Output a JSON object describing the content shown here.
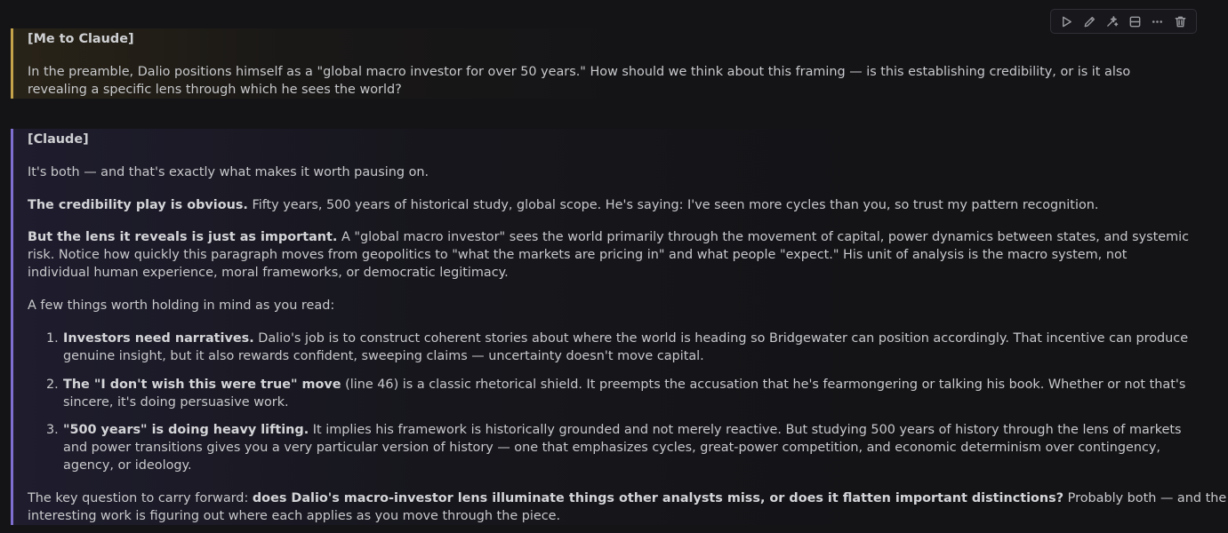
{
  "toolbar": {
    "items": [
      {
        "icon": "play-icon"
      },
      {
        "icon": "pencil-icon"
      },
      {
        "icon": "sparkles-icon"
      },
      {
        "icon": "split-icon"
      },
      {
        "icon": "more-icon"
      },
      {
        "icon": "trash-icon"
      }
    ]
  },
  "me_block": {
    "heading": "[Me to Claude]",
    "lines": [
      "In the preamble, Dalio positions himself as a \"global macro investor for over 50 years.\" How should we think about this framing — is this establishing credibility, or is it also",
      "revealing a specific lens through which he sees the world?"
    ]
  },
  "claude_block": {
    "heading": "[Claude]",
    "intro": "It's both — and that's exactly what makes it worth pausing on.",
    "p1": {
      "bold": "The credibility play is obvious.",
      "rest": " Fifty years, 500 years of historical study, global scope. He's saying: I've seen more cycles than you, so trust my pattern recognition."
    },
    "p2": {
      "bold": "But the lens it reveals is just as important.",
      "line1_rest": " A \"global macro investor\" sees the world primarily through the movement of capital, power dynamics between states, and systemic",
      "line2": "risk. Notice how quickly this paragraph moves from geopolitics to \"what the markets are pricing in\" and what people \"expect.\" His unit of analysis is the macro system, not",
      "line3": "individual human experience, moral frameworks, or democratic legitimacy."
    },
    "p3": "A few things worth holding in mind as you read:",
    "list": [
      {
        "num": "1.",
        "bold": "Investors need narratives.",
        "line1_rest": " Dalio's job is to construct coherent stories about where the world is heading so Bridgewater can position accordingly. That incentive can produce",
        "line2": "genuine insight, but it also rewards confident, sweeping claims — uncertainty doesn't move capital."
      },
      {
        "num": "2.",
        "bold": "The \"I don't wish this were true\" move",
        "line1_rest": " (line 46) is a classic rhetorical shield. It preempts the accusation that he's fearmongering or talking his book. Whether or not that's",
        "line2": "sincere, it's doing persuasive work."
      },
      {
        "num": "3.",
        "bold": "\"500 years\" is doing heavy lifting.",
        "line1_rest": " It implies his framework is historically grounded and not merely reactive. But studying 500 years of history through the lens of markets",
        "line2": "and power transitions gives you a very particular version of history — one that emphasizes cycles, great-power competition, and economic determinism over contingency,",
        "line3": "agency, or ideology."
      }
    ],
    "closing": {
      "start": "The key question to carry forward: ",
      "bold": "does Dalio's macro-investor lens illuminate things other analysts miss, or does it flatten important distinctions?",
      "rest": " Probably both — and the",
      "line2": "interesting work is figuring out where each applies as you move through the piece."
    }
  }
}
